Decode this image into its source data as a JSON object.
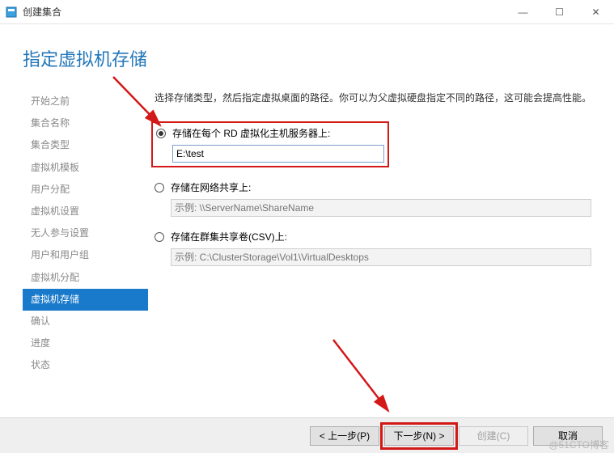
{
  "window": {
    "title": "创建集合",
    "controls": {
      "min": "—",
      "max": "☐",
      "close": "✕"
    }
  },
  "page_title": "指定虚拟机存储",
  "sidebar": {
    "items": [
      {
        "label": "开始之前"
      },
      {
        "label": "集合名称"
      },
      {
        "label": "集合类型"
      },
      {
        "label": "虚拟机模板"
      },
      {
        "label": "用户分配"
      },
      {
        "label": "虚拟机设置"
      },
      {
        "label": "无人参与设置"
      },
      {
        "label": "用户和用户组"
      },
      {
        "label": "虚拟机分配"
      },
      {
        "label": "虚拟机存储"
      },
      {
        "label": "确认"
      },
      {
        "label": "进度"
      },
      {
        "label": "状态"
      }
    ],
    "active_index": 9
  },
  "main": {
    "description": "选择存储类型，然后指定虚拟桌面的路径。你可以为父虚拟硬盘指定不同的路径，这可能会提高性能。",
    "options": [
      {
        "label": "存储在每个 RD 虚拟化主机服务器上:",
        "value": "E:\\test",
        "placeholder": "",
        "checked": true,
        "enabled": true
      },
      {
        "label": "存储在网络共享上:",
        "value": "",
        "placeholder": "示例: \\\\ServerName\\ShareName",
        "checked": false,
        "enabled": false
      },
      {
        "label": "存储在群集共享卷(CSV)上:",
        "value": "",
        "placeholder": "示例: C:\\ClusterStorage\\Vol1\\VirtualDesktops",
        "checked": false,
        "enabled": false
      }
    ]
  },
  "footer": {
    "prev": "< 上一步(P)",
    "next": "下一步(N) >",
    "create": "创建(C)",
    "cancel": "取消"
  },
  "watermark": "@51CTO博客"
}
